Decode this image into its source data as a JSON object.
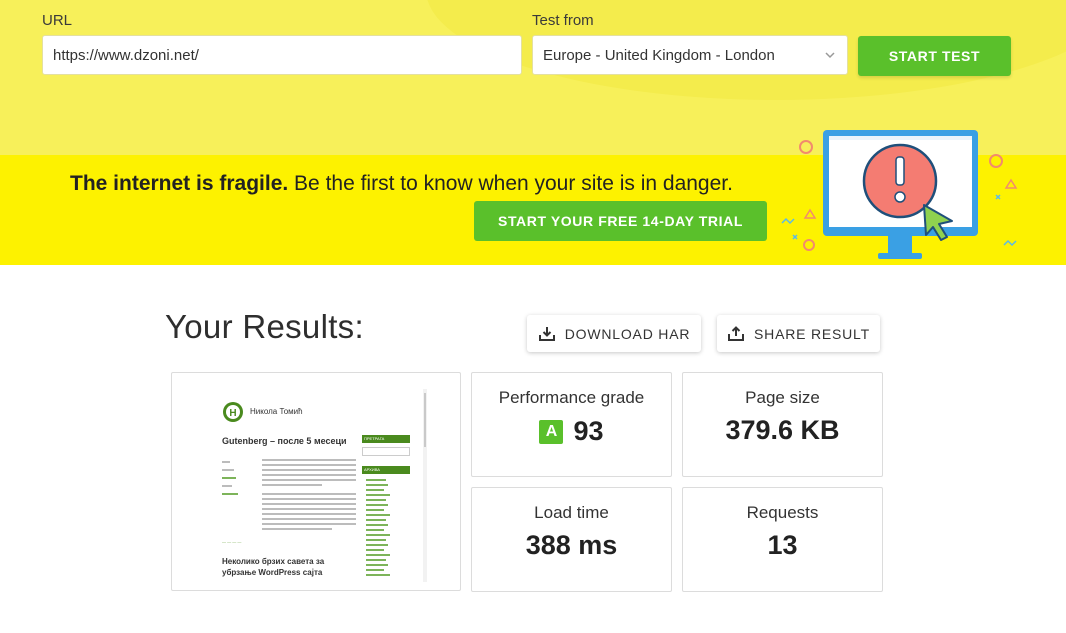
{
  "form": {
    "url_label": "URL",
    "url_value": "https://www.dzoni.net/",
    "test_from_label": "Test from",
    "test_from_value": "Europe - United Kingdom - London",
    "start_button": "START TEST"
  },
  "banner": {
    "headline_bold": "The internet is fragile.",
    "headline_rest": " Be the first to know when your site is in danger.",
    "trial_button": "START YOUR FREE 14-DAY TRIAL"
  },
  "results": {
    "title": "Your Results:",
    "download_har": "DOWNLOAD HAR",
    "share_result": "SHARE RESULT",
    "metrics": {
      "performance": {
        "label": "Performance grade",
        "grade": "A",
        "score": "93"
      },
      "page_size": {
        "label": "Page size",
        "value": "379.6 KB"
      },
      "load_time": {
        "label": "Load time",
        "value": "388 ms"
      },
      "requests": {
        "label": "Requests",
        "value": "13"
      }
    }
  },
  "thumbnail": {
    "site_name": "Никола Томић",
    "post_title": "Gutenberg – после 5 месеци",
    "next_post_title": "Неколико брзих савета за убрзање WordPress сајта",
    "sidebar_search": "ПРЕТРАГА",
    "sidebar_archive": "АРХИВА"
  },
  "colors": {
    "accent_green": "#5ac02b",
    "band_yellow": "#f7f05a",
    "banner_yellow": "#fdf200"
  }
}
